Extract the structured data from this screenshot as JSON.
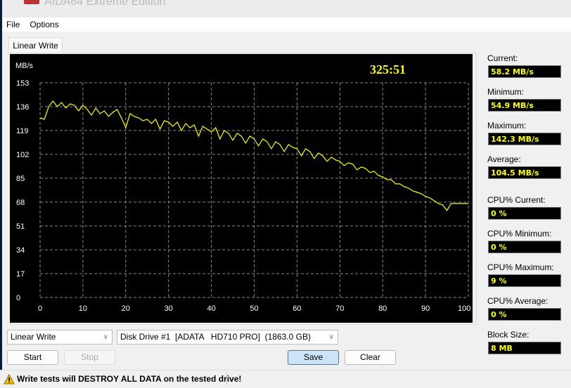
{
  "background_window": {
    "title": "AIDA64 Extreme Edition"
  },
  "menu": [
    "File",
    "Options"
  ],
  "tab": "Linear Write",
  "chart_data": {
    "type": "line",
    "ylabel": "MB/s",
    "timer": "325:51",
    "y_ticks": [
      0,
      17,
      34,
      51,
      68,
      85,
      102,
      119,
      136,
      153
    ],
    "x_ticks": [
      "0",
      "10",
      "20",
      "30",
      "40",
      "50",
      "60",
      "70",
      "80",
      "90",
      "100 %"
    ],
    "xlim": [
      0,
      100
    ],
    "ylim": [
      0,
      153
    ],
    "grid": true,
    "line_color": "#ffff00",
    "x": [
      0,
      1,
      2,
      3,
      4,
      5,
      6,
      7,
      8,
      9,
      10,
      11,
      12,
      13,
      14,
      15,
      16,
      17,
      18,
      19,
      20,
      21,
      22,
      23,
      24,
      25,
      26,
      27,
      28,
      29,
      30,
      31,
      32,
      33,
      34,
      35,
      36,
      37,
      38,
      39,
      40,
      41,
      42,
      43,
      44,
      45,
      46,
      47,
      48,
      49,
      50,
      51,
      52,
      53,
      54,
      55,
      56,
      57,
      58,
      59,
      60,
      61,
      62,
      63,
      64,
      65,
      66,
      67,
      68,
      69,
      70,
      71,
      72,
      73,
      74,
      75,
      76,
      77,
      78,
      79,
      80,
      81,
      82,
      83,
      84,
      85,
      86,
      87,
      88,
      89,
      90,
      91,
      92,
      93,
      94,
      95,
      96,
      100
    ],
    "y": [
      128,
      127,
      136,
      140,
      136,
      139,
      135,
      138,
      137,
      133,
      137,
      134,
      130,
      135,
      131,
      133,
      129,
      132,
      134,
      128,
      121,
      131,
      129,
      128,
      126,
      127,
      124,
      127,
      120,
      126,
      125,
      122,
      125,
      119,
      124,
      121,
      123,
      115,
      122,
      120,
      118,
      121,
      113,
      119,
      117,
      112,
      117,
      115,
      110,
      115,
      113,
      108,
      113,
      111,
      106,
      111,
      109,
      104,
      109,
      107,
      106,
      101,
      106,
      104,
      99,
      103,
      101,
      97,
      100,
      98,
      97,
      94,
      96,
      95,
      91,
      93,
      92,
      89,
      90,
      87,
      86,
      84,
      84,
      81,
      81,
      79,
      78,
      76,
      75,
      74,
      72,
      71,
      69,
      67,
      66,
      62,
      67,
      67
    ]
  },
  "stats": [
    {
      "label": "Current:",
      "value": "58.2 MB/s"
    },
    {
      "label": "Minimum:",
      "value": "54.9 MB/s"
    },
    {
      "label": "Maximum:",
      "value": "142.3 MB/s"
    },
    {
      "label": "Average:",
      "value": "104.5 MB/s"
    },
    {
      "label": "CPU% Current:",
      "value": "0 %"
    },
    {
      "label": "CPU% Minimum:",
      "value": "0 %"
    },
    {
      "label": "CPU% Maximum:",
      "value": "9 %"
    },
    {
      "label": "CPU% Average:",
      "value": "0 %"
    },
    {
      "label": "Block Size:",
      "value": "8 MB"
    }
  ],
  "controls": {
    "test_select": "Linear Write",
    "drive_select": "Disk Drive #1  [ADATA   HD710 PRO]  (1863.0 GB)",
    "start": "Start",
    "stop": "Stop",
    "save": "Save",
    "clear": "Clear"
  },
  "status": {
    "warning": "Write tests will DESTROY ALL DATA on the tested drive!"
  }
}
